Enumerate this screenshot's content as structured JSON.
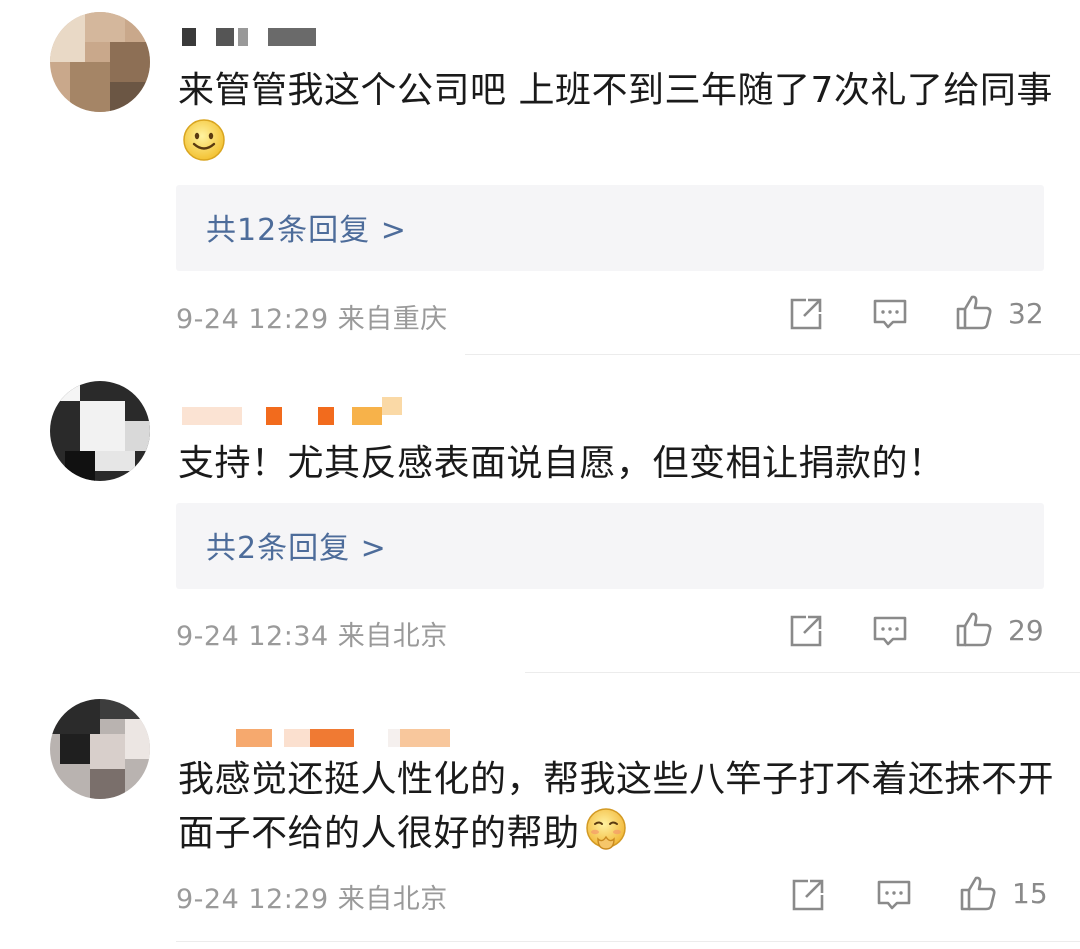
{
  "comments": [
    {
      "text": "来管管我这个公司吧 上班不到三年随了7次礼了给同事",
      "emoji": "smile-emoji",
      "replies": "共12条回复 >",
      "time": "9-24 12:29",
      "location": "来自重庆",
      "likes": "32"
    },
    {
      "text": "支持！尤其反感表面说自愿，但变相让捐款的！",
      "emoji": "",
      "replies": "共2条回复 >",
      "time": "9-24 12:34",
      "location": "来自北京",
      "likes": "29"
    },
    {
      "text": "我感觉还挺人性化的，帮我这些八竿子打不着还抹不开面子不给的人很好的帮助",
      "emoji": "pleading-emoji",
      "replies": "",
      "time": "9-24 12:29",
      "location": "来自北京",
      "likes": "15"
    }
  ],
  "icons": {
    "share": "share-icon",
    "comment": "comment-icon",
    "like": "thumbs-up-icon"
  },
  "colors": {
    "reply_link": "#4d6c9a",
    "meta": "#9a9a9a",
    "reply_bg": "#f5f5f7"
  }
}
